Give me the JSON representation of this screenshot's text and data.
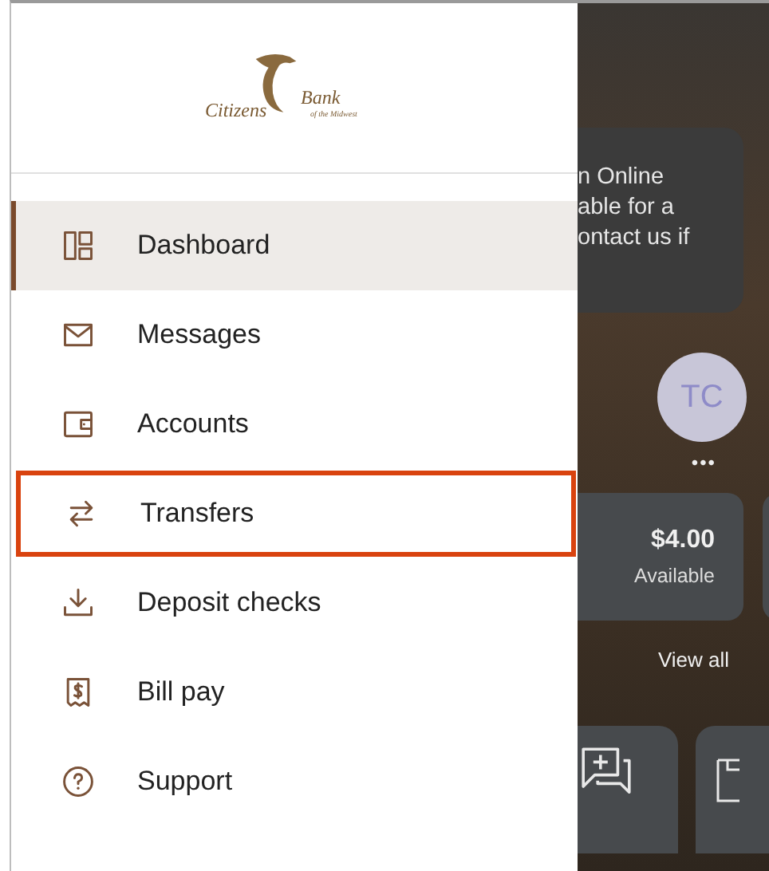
{
  "logo": {
    "name_left": "Citizens",
    "name_right": "Bank",
    "tagline": "of the Midwest"
  },
  "nav": [
    {
      "label": "Dashboard",
      "selected": true,
      "highlighted": false
    },
    {
      "label": "Messages",
      "selected": false,
      "highlighted": false
    },
    {
      "label": "Accounts",
      "selected": false,
      "highlighted": false
    },
    {
      "label": "Transfers",
      "selected": false,
      "highlighted": true
    },
    {
      "label": "Deposit checks",
      "selected": false,
      "highlighted": false
    },
    {
      "label": "Bill pay",
      "selected": false,
      "highlighted": false
    },
    {
      "label": "Support",
      "selected": false,
      "highlighted": false
    }
  ],
  "background": {
    "notice": "n Online\nable for a\nontact us if",
    "avatar": "TC",
    "more": "•••",
    "account": {
      "amount": "$4.00",
      "caption": "Available"
    },
    "view_all": "View all"
  }
}
